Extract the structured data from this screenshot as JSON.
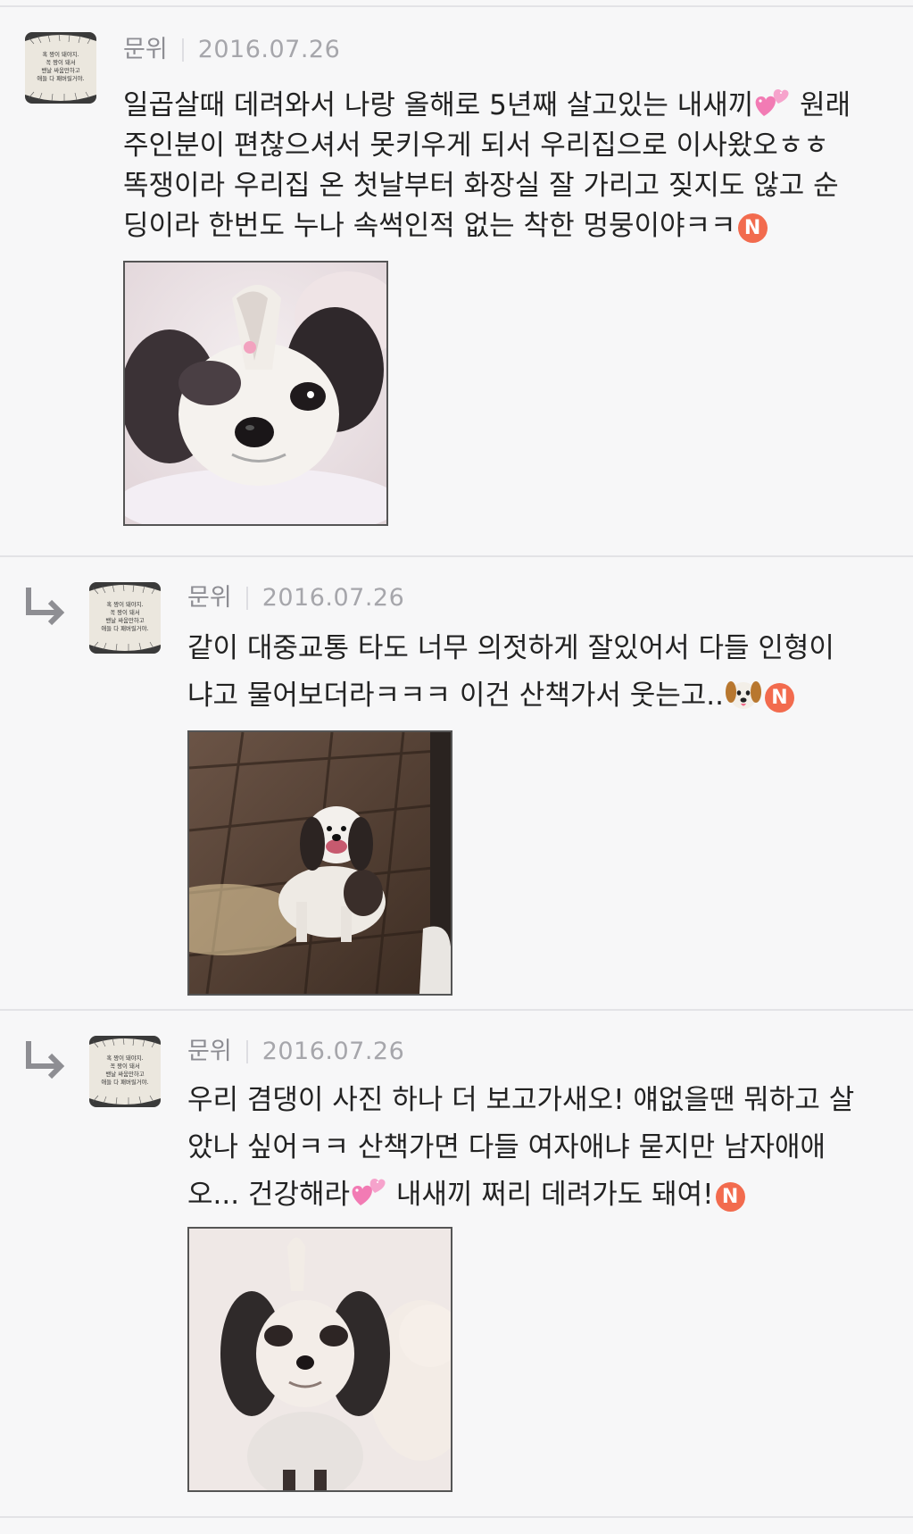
{
  "comments": [
    {
      "author": "문위",
      "date": "2016.07.26",
      "is_reply": false,
      "avatar_text": [
        "혹 짱이 돼야지.",
        "꼭 짱이 돼서",
        "밴날 싸움만하고",
        "애들 다 패버릴거야."
      ],
      "lines": [
        "일곱살때 데려와서 나랑 올해로 5년째 살고있는 내새끼",
        " 원래",
        "주인분이 편찮으셔서 못키우게 되서 우리집으로 이사왔오ㅎㅎ",
        "똑쟁이라 우리집 온 첫날부터 화장실 잘 가리고 짖지도 않고 순",
        "딩이라 한번도 누나 속썩인적 없는 착한 멍뭉이야ㅋㅋ"
      ],
      "new_badge": "N",
      "photo_label": "grooming photo"
    },
    {
      "author": "문위",
      "date": "2016.07.26",
      "is_reply": true,
      "avatar_text": [
        "혹 짱이 돼야지.",
        "꼭 짱이 돼서",
        "밴날 싸움만하고",
        "애들 다 패버릴거야."
      ],
      "lines": [
        "같이 대중교통 타도 너무 의젓하게 잘있어서 다들 인형이",
        "냐고 물어보더라ㅋㅋㅋ 이건 산책가서 웃는고.."
      ],
      "new_badge": "N"
    },
    {
      "author": "문위",
      "date": "2016.07.26",
      "is_reply": true,
      "avatar_text": [
        "혹 짱이 돼야지.",
        "꼭 짱이 돼서",
        "밴날 싸움만하고",
        "애들 다 패버릴거야."
      ],
      "lines": [
        "우리 겸댕이 사진 하나 더 보고가새오! 얘없을땐 뭐하고 살",
        "았나 싶어ㅋㅋ 산책가면 다들 여자애냐 묻지만 남자애애",
        "오... 건강해라",
        " 내새끼 쩌리 데려가도 돼여!"
      ],
      "new_badge": "N"
    }
  ],
  "colors": {
    "background": "#f7f7f8",
    "divider": "#e3e3e6",
    "author": "#8d8d93",
    "date": "#a6a6ab",
    "badge": "#f26b4e"
  },
  "icons": [
    "reply-arrow-icon",
    "sparkling-heart-emoji",
    "dog-face-emoji",
    "new-badge-icon"
  ]
}
